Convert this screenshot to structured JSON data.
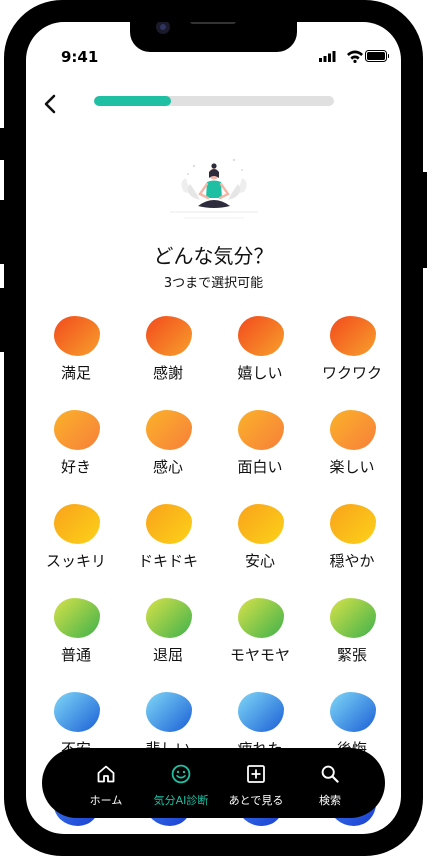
{
  "status": {
    "time": "9:41"
  },
  "progress": 0.32,
  "title": "どんな気分？",
  "subtitle": "3つまで選択可能",
  "moods": [
    {
      "label": "満足",
      "c1": "#f24a1d",
      "c2": "#f7a02c"
    },
    {
      "label": "感謝",
      "c1": "#f24a1d",
      "c2": "#f7a02c"
    },
    {
      "label": "嬉しい",
      "c1": "#f24a1d",
      "c2": "#f7a02c"
    },
    {
      "label": "ワクワク",
      "c1": "#f24a1d",
      "c2": "#f7a02c"
    },
    {
      "label": "好き",
      "c1": "#fbb22a",
      "c2": "#f77f3a"
    },
    {
      "label": "感心",
      "c1": "#fbb22a",
      "c2": "#f77f3a"
    },
    {
      "label": "面白い",
      "c1": "#fbb22a",
      "c2": "#f77f3a"
    },
    {
      "label": "楽しい",
      "c1": "#fbb22a",
      "c2": "#f77f3a"
    },
    {
      "label": "スッキリ",
      "c1": "#f9a21a",
      "c2": "#fcd219"
    },
    {
      "label": "ドキドキ",
      "c1": "#f9a21a",
      "c2": "#fcd219"
    },
    {
      "label": "安心",
      "c1": "#f9a21a",
      "c2": "#fcd219"
    },
    {
      "label": "穏やか",
      "c1": "#f9a21a",
      "c2": "#fcd219"
    },
    {
      "label": "普通",
      "c1": "#d7e24a",
      "c2": "#3fb14b"
    },
    {
      "label": "退屈",
      "c1": "#d7e24a",
      "c2": "#3fb14b"
    },
    {
      "label": "モヤモヤ",
      "c1": "#d7e24a",
      "c2": "#3fb14b"
    },
    {
      "label": "緊張",
      "c1": "#d7e24a",
      "c2": "#3fb14b"
    },
    {
      "label": "不安",
      "c1": "#7fd8f7",
      "c2": "#1b5fd6"
    },
    {
      "label": "悲しい",
      "c1": "#7fd8f7",
      "c2": "#1b5fd6"
    },
    {
      "label": "疲れた",
      "c1": "#7fd8f7",
      "c2": "#1b5fd6"
    },
    {
      "label": "後悔",
      "c1": "#7fd8f7",
      "c2": "#1b5fd6"
    }
  ],
  "nav": [
    {
      "label": "ホーム",
      "icon": "home-icon"
    },
    {
      "label": "気分AI診断",
      "icon": "smile-icon",
      "active": true
    },
    {
      "label": "あとで見る",
      "icon": "plus-square-icon"
    },
    {
      "label": "検索",
      "icon": "search-icon"
    }
  ],
  "colors": {
    "accent": "#1fbfa3",
    "tabbar": "#000000"
  }
}
